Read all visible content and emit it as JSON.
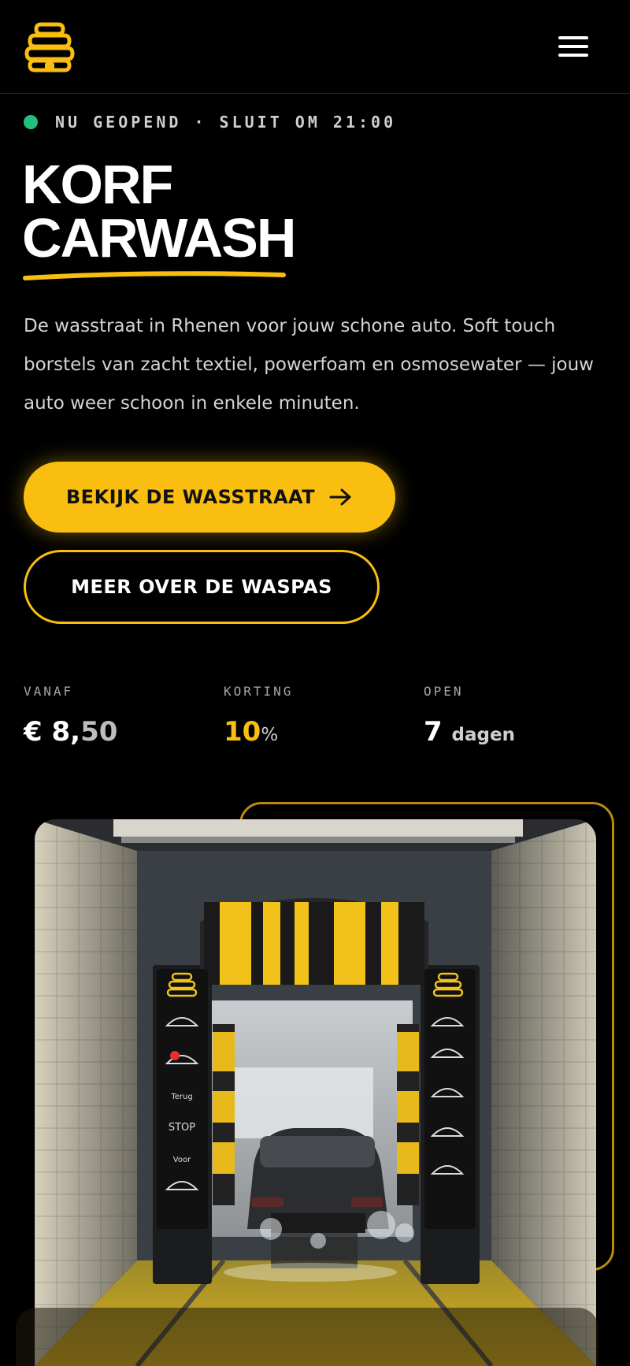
{
  "header": {
    "logo_icon": "beehive-logo-icon",
    "menu_icon": "hamburger-menu-icon"
  },
  "status": {
    "text": "NU GEOPEND · SLUIT OM 21:00",
    "dot_color": "#22c07a"
  },
  "hero": {
    "title_line1": "KORF",
    "title_line2": "CARWASH",
    "intro": "De wasstraat in Rhenen voor jouw schone auto. Soft touch borstels van zacht textiel, powerfoam en osmosewater — jouw auto weer schoon in enkele minuten."
  },
  "buttons": {
    "primary_label": "BEKIJK DE WASSTRAAT",
    "primary_icon": "arrow-right-icon",
    "secondary_label": "MEER OVER DE WASPAS"
  },
  "stats": {
    "from": {
      "label": "VANAF",
      "currency": "€ 8,",
      "cents": "50"
    },
    "discount": {
      "label": "KORTING",
      "value": "10",
      "unit": "%"
    },
    "open": {
      "label": "OPEN",
      "value": "7",
      "unit": "dagen"
    }
  },
  "colors": {
    "accent": "#f9be0f",
    "background": "#000000",
    "text": "#ffffff"
  },
  "photo": {
    "control_panel_labels": [
      "Terug",
      "STOP",
      "Voor"
    ]
  }
}
